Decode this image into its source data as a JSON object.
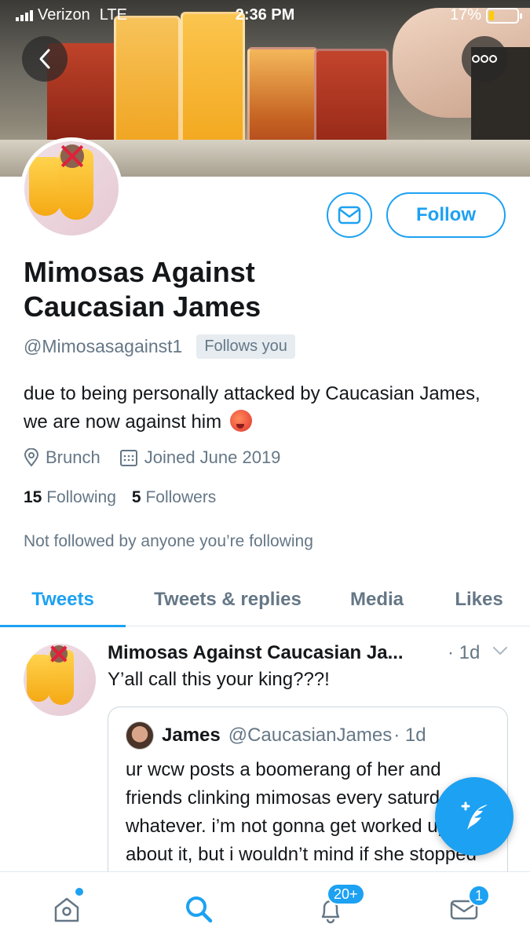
{
  "status_bar": {
    "carrier": "Verizon",
    "network": "LTE",
    "time": "2:36 PM",
    "battery_percent": "17%",
    "battery_level": 0.17,
    "battery_color": "#ffcc00"
  },
  "header": {
    "back_icon": "chevron-left-icon",
    "more_icon": "more-dots-icon"
  },
  "profile": {
    "name": "Mimosas Against Caucasian James",
    "handle": "@Mimosasagainst1",
    "follows_you": "Follows you",
    "bio": "due to being personally attacked by Caucasian James, we are now against him",
    "bio_emoji": "hot-face-emoji",
    "location": "Brunch",
    "joined": "Joined June 2019",
    "following_count": "15",
    "following_label": "Following",
    "followers_count": "5",
    "followers_label": "Followers",
    "not_followed": "Not followed by anyone you’re following",
    "follow_label": "Follow",
    "message_icon": "envelope-icon"
  },
  "tabs": [
    {
      "label": "Tweets",
      "active": true
    },
    {
      "label": "Tweets & replies",
      "active": false
    },
    {
      "label": "Media",
      "active": false
    },
    {
      "label": "Likes",
      "active": false
    }
  ],
  "tweet": {
    "author": "Mimosas Against Caucasian Ja...",
    "time": "· 1d",
    "text": "Y’all call this your king???!",
    "quote": {
      "name": "James",
      "handle": "@CaucasianJames",
      "time": "· 1d",
      "text": "ur wcw posts a boomerang of her and friends clinking mimosas every saturday. it’s whatever. i’m not gonna get worked up about it, but i wouldn’t mind if she stopped"
    }
  },
  "fab": {
    "icon": "compose-tweet-icon"
  },
  "bottom_nav": {
    "items": [
      {
        "name": "home-icon",
        "badge": ""
      },
      {
        "name": "search-icon",
        "badge": ""
      },
      {
        "name": "notifications-icon",
        "badge": "20+"
      },
      {
        "name": "messages-icon",
        "badge": "1"
      }
    ]
  },
  "colors": {
    "accent": "#1da1f2",
    "text": "#14171a",
    "muted": "#657786"
  }
}
